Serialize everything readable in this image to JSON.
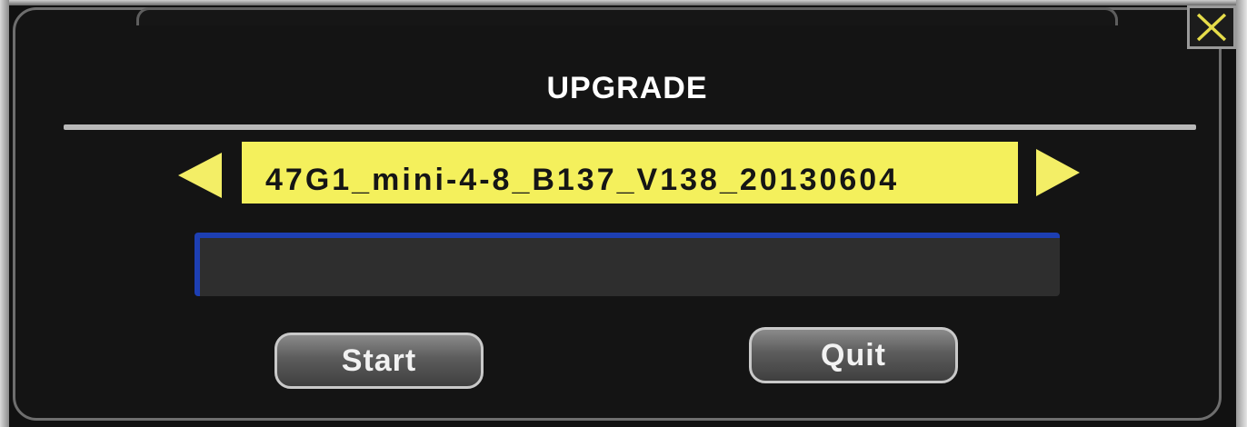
{
  "dialog": {
    "title": "UPGRADE",
    "close_icon": "close-icon"
  },
  "file_selector": {
    "value": "47G1_mini-4-8_B137_V138_20130604",
    "prev_icon": "left-arrow-icon",
    "next_icon": "right-arrow-icon"
  },
  "progress": {
    "percent": 0
  },
  "buttons": {
    "start_label": "Start",
    "quit_label": "Quit"
  },
  "colors": {
    "file_field_bg": "#f4f05c",
    "arrow": "#f3ee66",
    "progress_border": "#1d3fb3",
    "close_x": "#e6dd4a"
  }
}
